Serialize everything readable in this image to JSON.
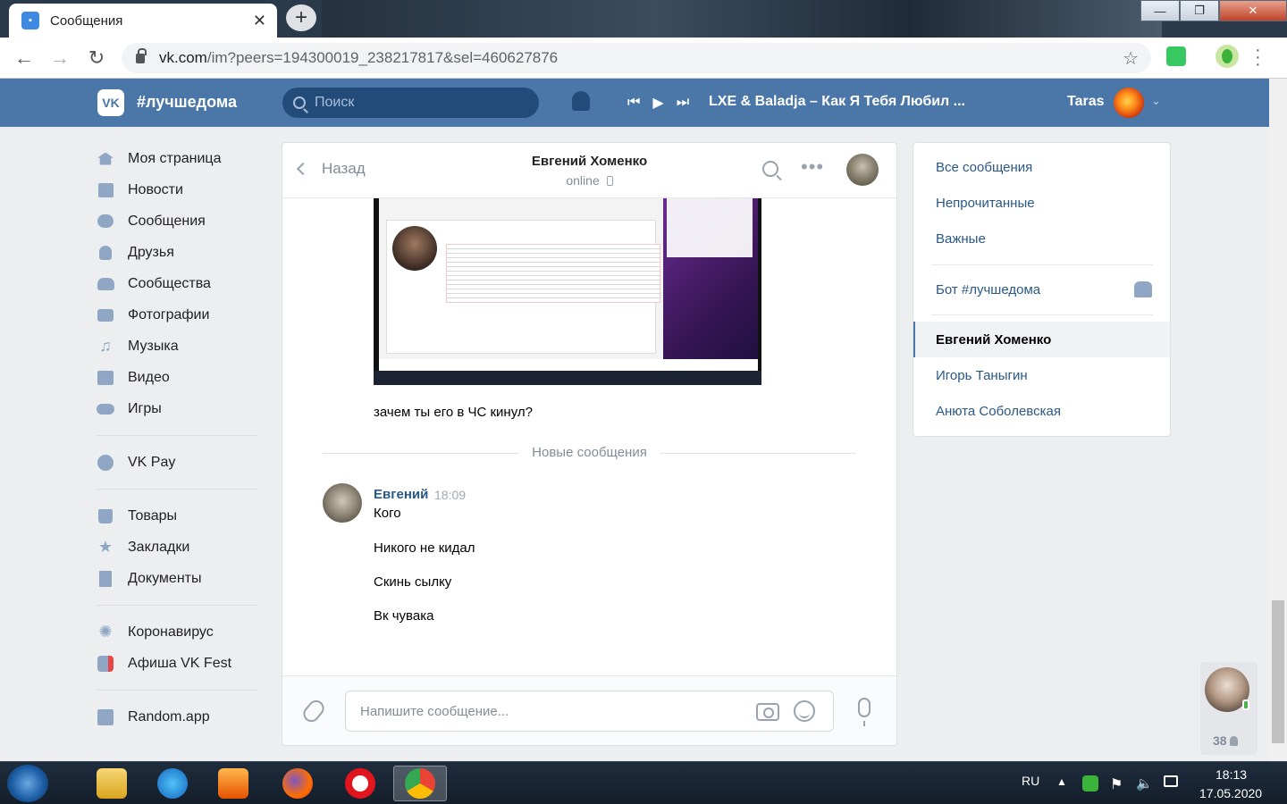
{
  "browser": {
    "tab_title": "Сообщения",
    "url_host": "vk.com",
    "url_path": "/im?peers=194300019_238217817&sel=460627876"
  },
  "header": {
    "brand": "#лучшедома",
    "search_placeholder": "Поиск",
    "track": "LXE & Baladja – Как Я Тебя Любил ...",
    "user_name": "Taras"
  },
  "leftnav": {
    "items": [
      {
        "label": "Моя страница",
        "icon": "home-icon"
      },
      {
        "label": "Новости",
        "icon": "news-icon"
      },
      {
        "label": "Сообщения",
        "icon": "messages-icon"
      },
      {
        "label": "Друзья",
        "icon": "friend-icon"
      },
      {
        "label": "Сообщества",
        "icon": "groups-icon"
      },
      {
        "label": "Фотографии",
        "icon": "camera-icon"
      },
      {
        "label": "Музыка",
        "icon": "music-icon"
      },
      {
        "label": "Видео",
        "icon": "video-icon"
      },
      {
        "label": "Игры",
        "icon": "gamepad-icon"
      },
      {
        "label": "VK Pay",
        "icon": "vkpay-icon"
      },
      {
        "label": "Товары",
        "icon": "bag-icon"
      },
      {
        "label": "Закладки",
        "icon": "star-icon"
      },
      {
        "label": "Документы",
        "icon": "document-icon"
      },
      {
        "label": "Коронавирус",
        "icon": "virus-icon"
      },
      {
        "label": "Афиша VK Fest",
        "icon": "fest-icon"
      },
      {
        "label": "Random.app",
        "icon": "app-icon"
      }
    ]
  },
  "chat": {
    "back_label": "Назад",
    "peer_name": "Евгений Хоменко",
    "peer_status": "online",
    "first_message": "зачем ты его в ЧС кинул?",
    "new_messages_label": "Новые сообщения",
    "author": "Евгений",
    "time": "18:09",
    "messages": [
      "Кого",
      "Никого не кидал",
      "Скинь сылку",
      "Вк чувака"
    ],
    "input_placeholder": "Напишите сообщение..."
  },
  "rightpanel": {
    "all": "Все сообщения",
    "unread": "Непрочитанные",
    "important": "Важные",
    "bot": "Бот #лучшедома",
    "convs": [
      "Евгений Хоменко",
      "Игорь Таныгин",
      "Анюта Соболевская"
    ]
  },
  "online_count": "38",
  "taskbar": {
    "lang": "RU",
    "time": "18:13",
    "date": "17.05.2020"
  },
  "colors": {
    "vk_blue": "#4a76a8",
    "link": "#2a5885",
    "bg": "#edeef0"
  }
}
